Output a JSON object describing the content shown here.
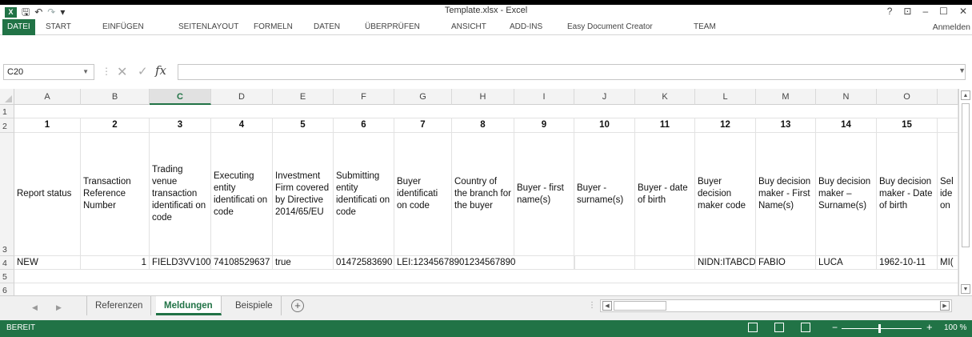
{
  "window": {
    "title": "Template.xlsx - Excel",
    "controls": [
      "?",
      "⊡",
      "–",
      "☐",
      "✕"
    ]
  },
  "ribbon": {
    "tabs": [
      "DATEI",
      "START",
      "EINFÜGEN",
      "SEITENLAYOUT",
      "FORMELN",
      "DATEN",
      "ÜBERPRÜFEN",
      "ANSICHT",
      "ADD-INS",
      "Easy Document Creator",
      "TEAM"
    ],
    "active_tab": "DATEI",
    "signin": "Anmelden"
  },
  "formula_bar": {
    "name_box": "C20",
    "fx": "fx",
    "formula": ""
  },
  "grid": {
    "selected_column": "C",
    "columns": [
      "A",
      "B",
      "C",
      "D",
      "E",
      "F",
      "G",
      "H",
      "I",
      "J",
      "K",
      "L",
      "M",
      "N",
      "O"
    ],
    "row_numbers": [
      "1",
      "2",
      "3",
      "4",
      "5",
      "6"
    ],
    "numbers_row": [
      "1",
      "2",
      "3",
      "4",
      "5",
      "6",
      "7",
      "8",
      "9",
      "10",
      "11",
      "12",
      "13",
      "14",
      "15"
    ],
    "headers": [
      "Report status",
      "Transaction Reference Number",
      "Trading venue transaction identificati on code",
      "Executing entity identificati on code",
      "Investment Firm covered by Directive 2014/65/EU",
      "Submitting entity identificati on code",
      "Buyer identificati on code",
      "Country of the branch for the buyer",
      "Buyer - first name(s)",
      "Buyer - surname(s)",
      "Buyer - date of birth",
      "Buyer decision maker code",
      "Buy decision maker - First Name(s)",
      "Buy decision maker – Surname(s)",
      "Buy decision maker - Date of birth",
      "Sel ide on"
    ],
    "row4": {
      "a": "NEW",
      "b": "1",
      "c": "FIELD3VV100",
      "d": "74108529637",
      "e": "true",
      "f": "01472583690",
      "g": "LEI:12345678901234567890",
      "l": "NIDN:ITABCD",
      "m": "FABIO",
      "n": "LUCA",
      "o": "1962-10-11",
      "p": "MI("
    }
  },
  "sheets": {
    "tabs": [
      "Referenzen",
      "Meldungen",
      "Beispiele"
    ],
    "active": "Meldungen",
    "add": "+"
  },
  "status": {
    "text": "BEREIT",
    "zoom": "100 %"
  },
  "colors": {
    "accent": "#217346"
  }
}
